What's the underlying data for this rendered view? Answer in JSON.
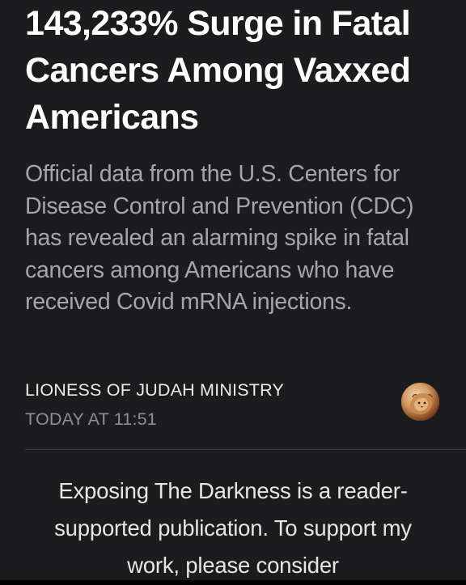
{
  "article": {
    "headline": "143,233% Surge in Fatal Cancers Among Vaxxed Americans",
    "subtitle": "Official data from the U.S. Centers for Disease Control and Prevention (CDC) has revealed an alarming spike in fatal cancers among Americans who have received Covid mRNA injections.",
    "author": "LIONESS OF JUDAH MINISTRY",
    "timestamp": "TODAY AT 11:51",
    "avatar_icon": "lioness-avatar-icon"
  },
  "promo": {
    "text": "Exposing The Darkness is a reader-supported publication. To support my work, please consider"
  },
  "colors": {
    "background": "#1c1c1e",
    "headline": "#ffffff",
    "subtitle": "#a6a6aa",
    "meta": "#8e8e93"
  }
}
